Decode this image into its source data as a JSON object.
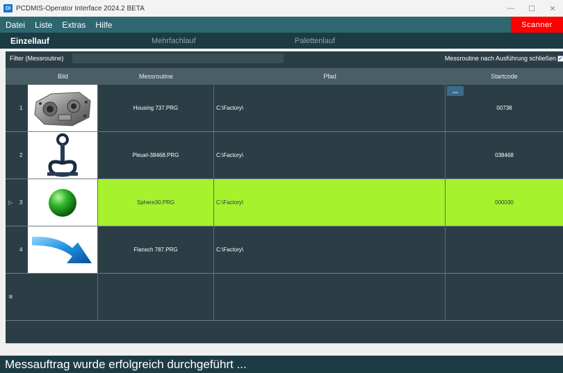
{
  "window": {
    "icon_text": "Ol",
    "title": "PCDMIS-Operator Interface 2024.2 BETA",
    "minimize": "—",
    "maximize": "☐",
    "close": "✕"
  },
  "menu": {
    "items": [
      "Datei",
      "Liste",
      "Extras",
      "Hilfe"
    ],
    "scanner_label": "Scanner",
    "scanner_color": "#ff0000",
    "bar_color": "#2f6770"
  },
  "modes": {
    "tabs": [
      {
        "label": "Einzellauf",
        "active": true
      },
      {
        "label": "Mehrfachlauf",
        "active": false
      },
      {
        "label": "Palettenlauf",
        "active": false
      }
    ]
  },
  "filter": {
    "label": "Filter (Messroutine)",
    "value": "",
    "close_option_label": "Messroutine nach Ausführung schließen",
    "close_option_checked": true
  },
  "grid": {
    "columns": [
      "Bild",
      "Messroutine",
      "Pfad",
      "Startcode"
    ],
    "rows": [
      {
        "num": "1",
        "image": "housing-part-image",
        "routine": "Housing 737.PRG",
        "path": "C:\\Factory\\",
        "startcode": "00738",
        "selected": false,
        "has_button": true,
        "button_label": "..."
      },
      {
        "num": "2",
        "image": "connecting-rod-image",
        "routine": "Pleuel-38468.PRG",
        "path": "C:\\Factory\\",
        "startcode": "038468",
        "selected": false
      },
      {
        "num": "3",
        "image": "green-sphere-image",
        "routine": "Sphere30.PRG",
        "path": "C:\\Factory\\",
        "startcode": "000030",
        "selected": true,
        "marker": "▷"
      },
      {
        "num": "4",
        "image": "blue-arrow-image",
        "routine": "Flansch 787.PRG",
        "path": "C:\\Factory\\",
        "startcode": "",
        "selected": false
      }
    ],
    "new_row_marker": "✲",
    "selected_color": "#a6f22c"
  },
  "status": {
    "message": "Messauftrag wurde erfolgreich durchgeführt ..."
  }
}
